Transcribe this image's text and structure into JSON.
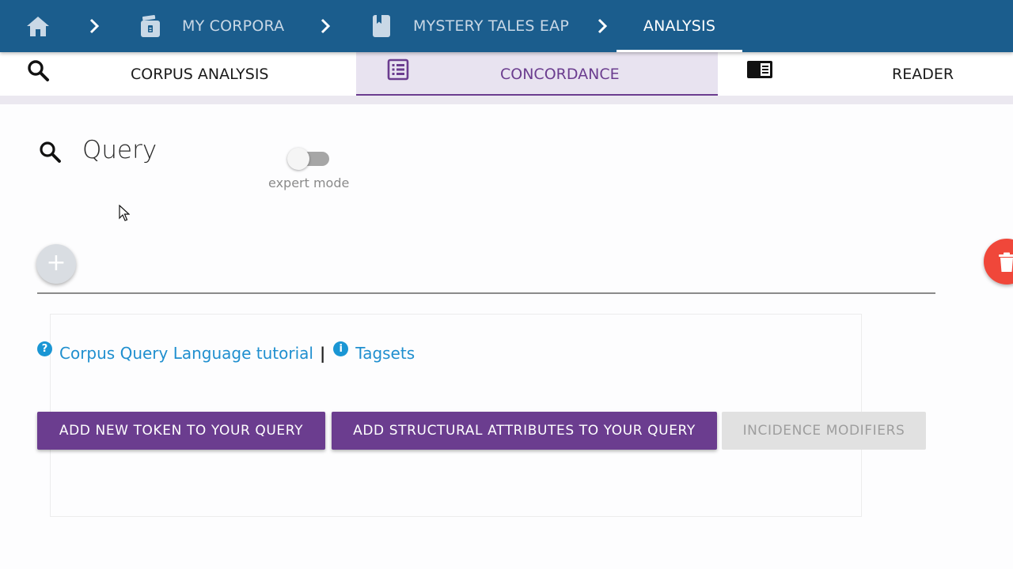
{
  "breadcrumb": {
    "items": [
      {
        "label": "",
        "icon": "home-icon"
      },
      {
        "label": "MY CORPORA",
        "icon": "archive-icon"
      },
      {
        "label": "MYSTERY TALES EAP",
        "icon": "book-icon"
      },
      {
        "label": "ANALYSIS",
        "icon": ""
      }
    ],
    "separator_icon": "chevron-right-icon"
  },
  "tabs": [
    {
      "label": "CORPUS ANALYSIS",
      "icon": "search-icon",
      "active": false
    },
    {
      "label": "CONCORDANCE",
      "icon": "list-box-icon",
      "active": true
    },
    {
      "label": "READER",
      "icon": "reader-icon",
      "active": false
    }
  ],
  "query": {
    "title": "Query",
    "expert_mode_label": "expert mode",
    "expert_mode_on": false
  },
  "help": {
    "cql_tutorial": "Corpus Query Language tutorial",
    "separator": "|",
    "tagsets": "Tagsets"
  },
  "buttons": {
    "add_token": "ADD NEW TOKEN TO YOUR QUERY",
    "add_structural": "ADD STRUCTURAL ATTRIBUTES TO YOUR QUERY",
    "incidence_modifiers": "INCIDENCE MODIFIERS"
  },
  "colors": {
    "header": "#1b5d8d",
    "accent": "#6b3d8f",
    "link": "#1f8fcf",
    "danger": "#f0473a",
    "disabled": "#e1e1e1"
  }
}
